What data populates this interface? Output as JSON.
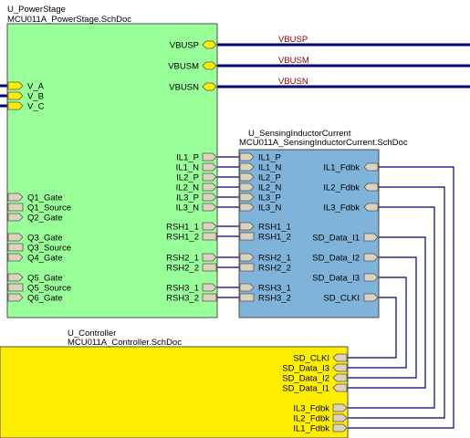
{
  "colors": {
    "powerstage_fill": "#99ff99",
    "sensing_fill": "#7fb3d9",
    "controller_fill": "#ffee00",
    "bus_wire": "#00007a",
    "signal_wire": "#00007a",
    "port_fill": "#dcd3bf",
    "net_label": "#8b0000"
  },
  "powerstage": {
    "designator": "U_PowerStage",
    "filename": "MCU011A_PowerStage.SchDoc",
    "right_ports": [
      "VBUSP",
      "VBUSM",
      "VBUSN",
      "IL1_P",
      "IL1_N",
      "IL2_P",
      "IL2_N",
      "IL3_P",
      "IL3_N",
      "RSH1_1",
      "RSH1_2",
      "RSH2_1",
      "RSH2_2",
      "RSH3_1",
      "RSH3_2"
    ],
    "left_ports": [
      "V_A",
      "V_B",
      "V_C",
      "Q1_Gate",
      "Q1_Source",
      "Q2_Gate",
      "Q3_Gate",
      "Q3_Source",
      "Q4_Gate",
      "Q5_Gate",
      "Q5_Source",
      "Q6_Gate"
    ]
  },
  "bus_nets": [
    "VBUSP",
    "VBUSM",
    "VBUSN"
  ],
  "sensing": {
    "designator": "U_SensingInductorCurrent",
    "filename": "MCU011A_SensingInductorCurrent.SchDoc",
    "left_ports": [
      "IL1_P",
      "IL1_N",
      "IL2_P",
      "IL2_N",
      "IL3_P",
      "IL3_N",
      "RSH1_1",
      "RSH1_2",
      "RSH2_1",
      "RSH2_2",
      "RSH3_1",
      "RSH3_2"
    ],
    "right_ports": [
      "IL1_Fdbk",
      "IL2_Fdbk",
      "IL3_Fdbk",
      "SD_Data_I1",
      "SD_Data_I2",
      "SD_Data_I3",
      "SD_CLKI"
    ]
  },
  "controller": {
    "designator": "U_Controller",
    "filename": "MCU011A_Controller.SchDoc",
    "right_ports": [
      "SD_CLKI",
      "SD_Data_I3",
      "SD_Data_I2",
      "SD_Data_I1",
      "IL3_Fdbk",
      "IL2_Fdbk",
      "IL1_Fdbk"
    ]
  }
}
